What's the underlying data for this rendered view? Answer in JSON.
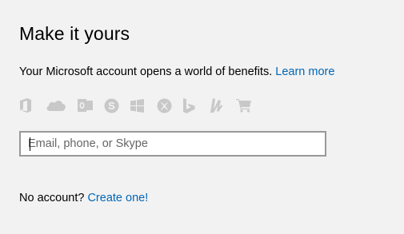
{
  "header": {
    "title": "Make it yours"
  },
  "intro": {
    "text": "Your Microsoft account opens a world of benefits. ",
    "learn_more": "Learn more"
  },
  "service_icons": [
    "office-icon",
    "onedrive-icon",
    "outlook-icon",
    "skype-icon",
    "windows-icon",
    "xbox-icon",
    "bing-icon",
    "msn-icon",
    "store-icon"
  ],
  "signin": {
    "placeholder": "Email, phone, or Skype",
    "value": ""
  },
  "footer": {
    "prompt": "No account? ",
    "create_link": "Create one!"
  },
  "colors": {
    "link": "#0067b8",
    "icon": "#c8c8c8",
    "background": "#f2f2f2",
    "input_border": "#999999"
  }
}
